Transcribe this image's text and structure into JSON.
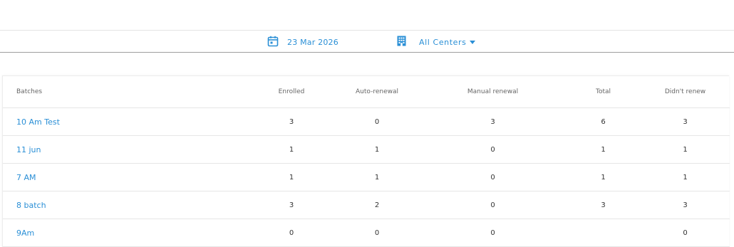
{
  "filters": {
    "date": "23 Mar 2026",
    "center": "All Centers"
  },
  "table": {
    "headers": {
      "batches": "Batches",
      "enrolled": "Enrolled",
      "auto_renewal": "Auto-renewal",
      "manual_renewal": "Manual renewal",
      "total": "Total",
      "didnt_renew": "Didn't renew"
    },
    "rows": [
      {
        "batch": "10 Am Test",
        "enrolled": "3",
        "auto_renewal": "0",
        "manual_renewal": "3",
        "total": "6",
        "didnt_renew": "3"
      },
      {
        "batch": "11 jun",
        "enrolled": "1",
        "auto_renewal": "1",
        "manual_renewal": "0",
        "total": "1",
        "didnt_renew": "1"
      },
      {
        "batch": "7 AM",
        "enrolled": "1",
        "auto_renewal": "1",
        "manual_renewal": "0",
        "total": "1",
        "didnt_renew": "1"
      },
      {
        "batch": "8 batch",
        "enrolled": "3",
        "auto_renewal": "2",
        "manual_renewal": "0",
        "total": "3",
        "didnt_renew": "3"
      },
      {
        "batch": "9Am",
        "enrolled": "0",
        "auto_renewal": "0",
        "manual_renewal": "0",
        "total": "",
        "didnt_renew": "0"
      }
    ]
  },
  "icons": {
    "date": "calendar-icon",
    "center": "building-icon",
    "dropdown": "caret-down-icon"
  },
  "colors": {
    "accent": "#2a8fd6"
  }
}
